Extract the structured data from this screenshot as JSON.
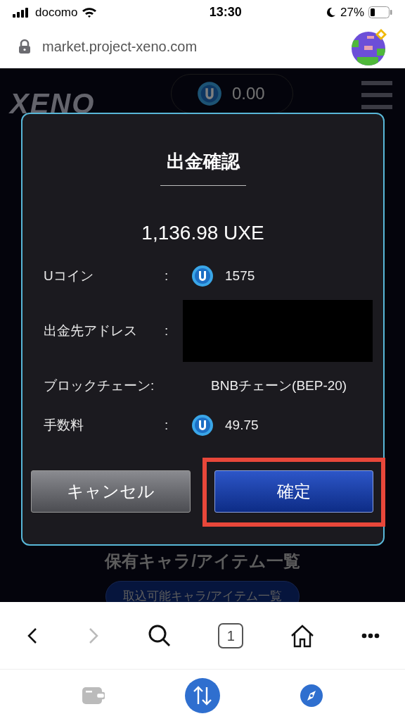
{
  "status_bar": {
    "carrier": "docomo",
    "time": "13:30",
    "battery": "27%"
  },
  "address_bar": {
    "url": "market.project-xeno.com"
  },
  "background_page": {
    "logo": "XENO",
    "balance": "0.00",
    "section_title": "保有キャラ/アイテム一覧",
    "list_button": "取込可能キャラ/アイテム一覧"
  },
  "dialog": {
    "title": "出金確認",
    "amount": "1,136.98 UXE",
    "rows": [
      {
        "label": "Uコイン",
        "separator": ":",
        "kind": "coin",
        "value": "1575"
      },
      {
        "label": "出金先アドレス",
        "separator": ":",
        "kind": "redacted"
      },
      {
        "label": "ブロックチェーン:",
        "kind": "text",
        "value": "BNBチェーン(BEP-20)"
      },
      {
        "label": "手数料",
        "separator": ":",
        "kind": "coin",
        "value": "49.75"
      }
    ],
    "buttons": [
      {
        "label": "キャンセル",
        "kind": "secondary",
        "highlighted": false
      },
      {
        "label": "確定",
        "kind": "primary",
        "highlighted": true
      }
    ]
  },
  "browser_toolbar": {
    "tabs_count": "1"
  }
}
